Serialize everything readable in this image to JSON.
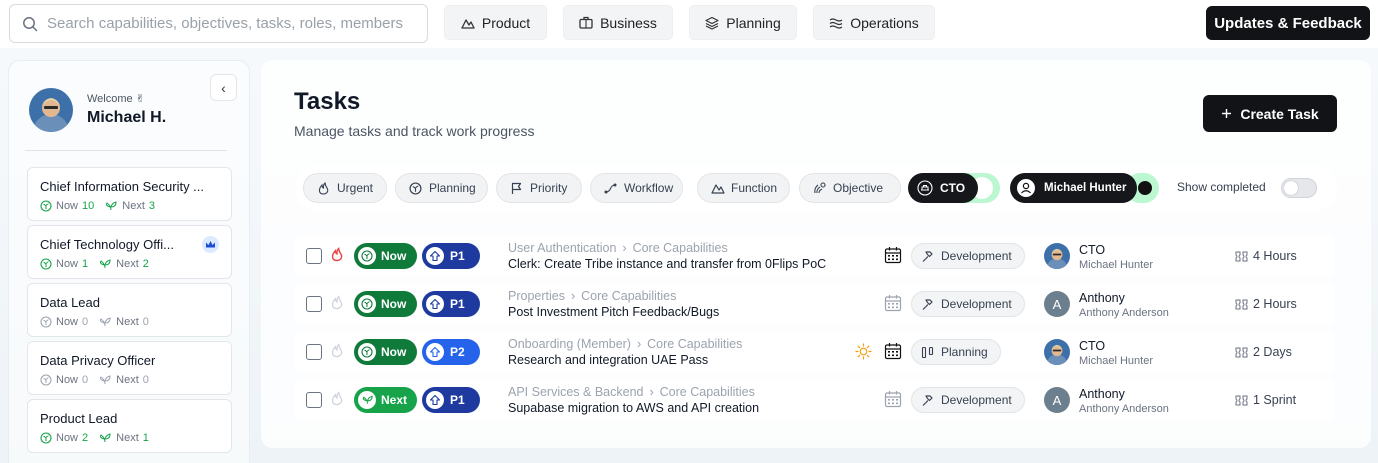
{
  "topbar": {
    "search_placeholder": "Search capabilities, objectives, tasks, roles, members",
    "nav": [
      {
        "label": "Product",
        "icon": "mountain-icon"
      },
      {
        "label": "Business",
        "icon": "briefcase-icon"
      },
      {
        "label": "Planning",
        "icon": "layers-icon"
      },
      {
        "label": "Operations",
        "icon": "waves-icon"
      }
    ],
    "updates_label": "Updates & Feedback"
  },
  "sidebar": {
    "welcome": "Welcome ✌",
    "user_name": "Michael H.",
    "collapse_glyph": "‹",
    "roles": [
      {
        "title": "Chief Information Security ...",
        "now_label": "Now",
        "now": "10",
        "next_label": "Next",
        "next": "3",
        "crown": false
      },
      {
        "title": "Chief Technology Offi...",
        "now_label": "Now",
        "now": "1",
        "next_label": "Next",
        "next": "2",
        "crown": true
      },
      {
        "title": "Data Lead",
        "now_label": "Now",
        "now": "0",
        "next_label": "Next",
        "next": "0",
        "crown": false
      },
      {
        "title": "Data Privacy Officer",
        "now_label": "Now",
        "now": "0",
        "next_label": "Next",
        "next": "0",
        "crown": false
      },
      {
        "title": "Product Lead",
        "now_label": "Now",
        "now": "2",
        "next_label": "Next",
        "next": "1",
        "crown": false
      }
    ]
  },
  "main": {
    "title": "Tasks",
    "subtitle": "Manage tasks and track work progress",
    "create_label": "Create Task",
    "filters": {
      "chips": [
        {
          "label": "Urgent",
          "icon": "flame-icon"
        },
        {
          "label": "Planning",
          "icon": "sprout-icon"
        },
        {
          "label": "Priority",
          "icon": "flag-icon"
        },
        {
          "label": "Workflow",
          "icon": "workflow-icon"
        },
        {
          "label": "Function",
          "icon": "mountain-icon"
        },
        {
          "label": "Objective",
          "icon": "target-icon"
        }
      ],
      "role_toggle": "CTO",
      "member_toggle": "Michael Hunter",
      "show_completed": "Show completed"
    },
    "tasks": [
      {
        "urgent": true,
        "status": "Now",
        "priority": "P1",
        "capability": "User Authentication",
        "area": "Core Capabilities",
        "title": "Clerk: Create Tribe instance and transfer from 0Flips PoC",
        "sun": false,
        "function": "Development",
        "assignee": "CTO",
        "assignee_sub": "Michael Hunter",
        "avatar": "photo",
        "estimate": "4 Hours"
      },
      {
        "urgent": false,
        "status": "Now",
        "priority": "P1",
        "capability": "Properties",
        "area": "Core Capabilities",
        "title": "Post Investment Pitch Feedback/Bugs",
        "sun": false,
        "function": "Development",
        "assignee": "Anthony",
        "assignee_sub": "Anthony Anderson",
        "avatar": "A",
        "estimate": "2 Hours"
      },
      {
        "urgent": false,
        "status": "Now",
        "priority": "P2",
        "capability": "Onboarding (Member)",
        "area": "Core Capabilities",
        "title": "Research and integration UAE Pass",
        "sun": true,
        "function": "Planning",
        "assignee": "CTO",
        "assignee_sub": "Michael Hunter",
        "avatar": "photo",
        "estimate": "2 Days"
      },
      {
        "urgent": false,
        "status": "Next",
        "priority": "P1",
        "capability": "API Services & Backend",
        "area": "Core Capabilities",
        "title": "Supabase migration to AWS and API creation",
        "sun": false,
        "function": "Development",
        "assignee": "Anthony",
        "assignee_sub": "Anthony Anderson",
        "avatar": "A",
        "estimate": "1 Sprint"
      }
    ]
  },
  "colors": {
    "status_now": "#0f7a3a",
    "status_next": "#16a34a",
    "priority_p1": "#1e3a9e",
    "priority_p2": "#2563eb",
    "dark_button": "#111316",
    "toggle_on": "#bbf7d0"
  }
}
